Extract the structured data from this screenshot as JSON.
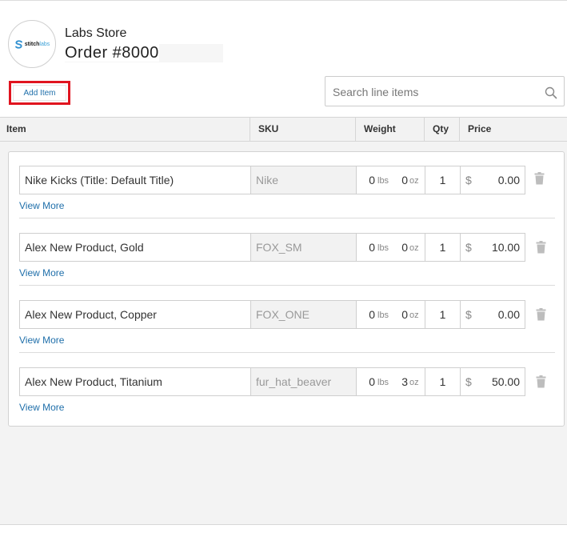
{
  "header": {
    "logo": {
      "word_bold": "stitch",
      "word_light": "labs",
      "icon": "stitch-logo-icon"
    },
    "store_name": "Labs Store",
    "order_title": "Order #8000"
  },
  "toolbar": {
    "add_item_label": "Add Item"
  },
  "search": {
    "placeholder": "Search line items",
    "value": "",
    "icon": "search-icon"
  },
  "columns": [
    "Item",
    "SKU",
    "Weight",
    "Qty",
    "Price"
  ],
  "line_items": [
    {
      "name": "Nike Kicks (Title: Default Title)",
      "sku": "Nike",
      "weight_lbs": "0",
      "weight_lbs_unit": "lbs",
      "weight_oz": "0",
      "weight_oz_unit": "oz",
      "qty": "1",
      "currency": "$",
      "price": "0.00",
      "view_more": "View More"
    },
    {
      "name": "Alex New Product, Gold",
      "sku": "FOX_SM",
      "weight_lbs": "0",
      "weight_lbs_unit": "lbs",
      "weight_oz": "0",
      "weight_oz_unit": "oz",
      "qty": "1",
      "currency": "$",
      "price": "10.00",
      "view_more": "View More"
    },
    {
      "name": "Alex New Product, Copper",
      "sku": "FOX_ONE",
      "weight_lbs": "0",
      "weight_lbs_unit": "lbs",
      "weight_oz": "0",
      "weight_oz_unit": "oz",
      "qty": "1",
      "currency": "$",
      "price": "0.00",
      "view_more": "View More"
    },
    {
      "name": "Alex New Product, Titanium",
      "sku": "fur_hat_beaver",
      "weight_lbs": "0",
      "weight_lbs_unit": "lbs",
      "weight_oz": "3",
      "weight_oz_unit": "oz",
      "qty": "1",
      "currency": "$",
      "price": "50.00",
      "view_more": "View More"
    }
  ],
  "colors": {
    "accent_link": "#1f6faa",
    "highlight_outline": "#e0141f",
    "body_background": "#f3f3f3",
    "header_background": "#f2f2f2"
  }
}
